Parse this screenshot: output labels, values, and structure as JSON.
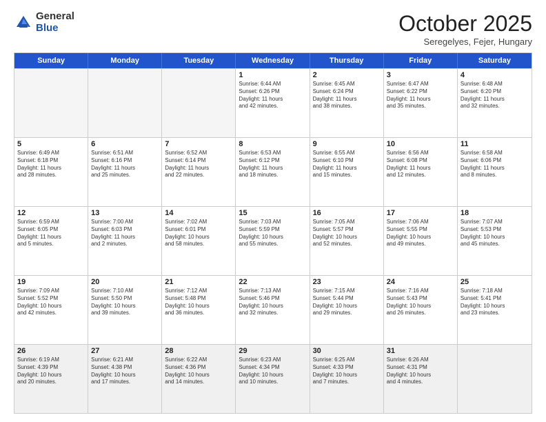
{
  "logo": {
    "general": "General",
    "blue": "Blue"
  },
  "header": {
    "month": "October 2025",
    "location": "Seregelyes, Fejer, Hungary"
  },
  "days_of_week": [
    "Sunday",
    "Monday",
    "Tuesday",
    "Wednesday",
    "Thursday",
    "Friday",
    "Saturday"
  ],
  "rows": [
    [
      {
        "day": "",
        "info": ""
      },
      {
        "day": "",
        "info": ""
      },
      {
        "day": "",
        "info": ""
      },
      {
        "day": "1",
        "info": "Sunrise: 6:44 AM\nSunset: 6:26 PM\nDaylight: 11 hours\nand 42 minutes."
      },
      {
        "day": "2",
        "info": "Sunrise: 6:45 AM\nSunset: 6:24 PM\nDaylight: 11 hours\nand 38 minutes."
      },
      {
        "day": "3",
        "info": "Sunrise: 6:47 AM\nSunset: 6:22 PM\nDaylight: 11 hours\nand 35 minutes."
      },
      {
        "day": "4",
        "info": "Sunrise: 6:48 AM\nSunset: 6:20 PM\nDaylight: 11 hours\nand 32 minutes."
      }
    ],
    [
      {
        "day": "5",
        "info": "Sunrise: 6:49 AM\nSunset: 6:18 PM\nDaylight: 11 hours\nand 28 minutes."
      },
      {
        "day": "6",
        "info": "Sunrise: 6:51 AM\nSunset: 6:16 PM\nDaylight: 11 hours\nand 25 minutes."
      },
      {
        "day": "7",
        "info": "Sunrise: 6:52 AM\nSunset: 6:14 PM\nDaylight: 11 hours\nand 22 minutes."
      },
      {
        "day": "8",
        "info": "Sunrise: 6:53 AM\nSunset: 6:12 PM\nDaylight: 11 hours\nand 18 minutes."
      },
      {
        "day": "9",
        "info": "Sunrise: 6:55 AM\nSunset: 6:10 PM\nDaylight: 11 hours\nand 15 minutes."
      },
      {
        "day": "10",
        "info": "Sunrise: 6:56 AM\nSunset: 6:08 PM\nDaylight: 11 hours\nand 12 minutes."
      },
      {
        "day": "11",
        "info": "Sunrise: 6:58 AM\nSunset: 6:06 PM\nDaylight: 11 hours\nand 8 minutes."
      }
    ],
    [
      {
        "day": "12",
        "info": "Sunrise: 6:59 AM\nSunset: 6:05 PM\nDaylight: 11 hours\nand 5 minutes."
      },
      {
        "day": "13",
        "info": "Sunrise: 7:00 AM\nSunset: 6:03 PM\nDaylight: 11 hours\nand 2 minutes."
      },
      {
        "day": "14",
        "info": "Sunrise: 7:02 AM\nSunset: 6:01 PM\nDaylight: 10 hours\nand 58 minutes."
      },
      {
        "day": "15",
        "info": "Sunrise: 7:03 AM\nSunset: 5:59 PM\nDaylight: 10 hours\nand 55 minutes."
      },
      {
        "day": "16",
        "info": "Sunrise: 7:05 AM\nSunset: 5:57 PM\nDaylight: 10 hours\nand 52 minutes."
      },
      {
        "day": "17",
        "info": "Sunrise: 7:06 AM\nSunset: 5:55 PM\nDaylight: 10 hours\nand 49 minutes."
      },
      {
        "day": "18",
        "info": "Sunrise: 7:07 AM\nSunset: 5:53 PM\nDaylight: 10 hours\nand 45 minutes."
      }
    ],
    [
      {
        "day": "19",
        "info": "Sunrise: 7:09 AM\nSunset: 5:52 PM\nDaylight: 10 hours\nand 42 minutes."
      },
      {
        "day": "20",
        "info": "Sunrise: 7:10 AM\nSunset: 5:50 PM\nDaylight: 10 hours\nand 39 minutes."
      },
      {
        "day": "21",
        "info": "Sunrise: 7:12 AM\nSunset: 5:48 PM\nDaylight: 10 hours\nand 36 minutes."
      },
      {
        "day": "22",
        "info": "Sunrise: 7:13 AM\nSunset: 5:46 PM\nDaylight: 10 hours\nand 32 minutes."
      },
      {
        "day": "23",
        "info": "Sunrise: 7:15 AM\nSunset: 5:44 PM\nDaylight: 10 hours\nand 29 minutes."
      },
      {
        "day": "24",
        "info": "Sunrise: 7:16 AM\nSunset: 5:43 PM\nDaylight: 10 hours\nand 26 minutes."
      },
      {
        "day": "25",
        "info": "Sunrise: 7:18 AM\nSunset: 5:41 PM\nDaylight: 10 hours\nand 23 minutes."
      }
    ],
    [
      {
        "day": "26",
        "info": "Sunrise: 6:19 AM\nSunset: 4:39 PM\nDaylight: 10 hours\nand 20 minutes."
      },
      {
        "day": "27",
        "info": "Sunrise: 6:21 AM\nSunset: 4:38 PM\nDaylight: 10 hours\nand 17 minutes."
      },
      {
        "day": "28",
        "info": "Sunrise: 6:22 AM\nSunset: 4:36 PM\nDaylight: 10 hours\nand 14 minutes."
      },
      {
        "day": "29",
        "info": "Sunrise: 6:23 AM\nSunset: 4:34 PM\nDaylight: 10 hours\nand 10 minutes."
      },
      {
        "day": "30",
        "info": "Sunrise: 6:25 AM\nSunset: 4:33 PM\nDaylight: 10 hours\nand 7 minutes."
      },
      {
        "day": "31",
        "info": "Sunrise: 6:26 AM\nSunset: 4:31 PM\nDaylight: 10 hours\nand 4 minutes."
      },
      {
        "day": "",
        "info": ""
      }
    ]
  ]
}
